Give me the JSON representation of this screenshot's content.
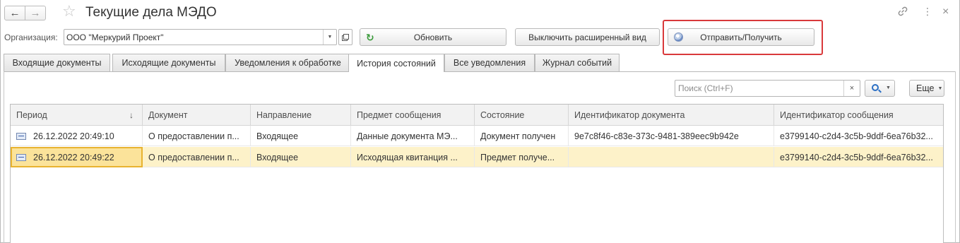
{
  "window": {
    "title": "Текущие дела МЭДО",
    "back_icon": "←",
    "forward_icon": "→",
    "favorite_icon": "☆",
    "link_icon": "🔗",
    "more_icon": "⋮",
    "close_icon": "×"
  },
  "toolbar": {
    "org_label": "Организация:",
    "org_value": "ООО \"Меркурий Проект\"",
    "refresh_label": "Обновить",
    "extended_label": "Выключить расширенный вид",
    "send_label": "Отправить/Получить"
  },
  "tabs": [
    {
      "label": "Входящие документы",
      "active": false
    },
    {
      "label": "Исходящие документы",
      "active": false
    },
    {
      "label": "Уведомления к обработке",
      "active": false
    },
    {
      "label": "История состояний",
      "active": true
    },
    {
      "label": "Все уведомления",
      "active": false
    },
    {
      "label": "Журнал событий",
      "active": false
    }
  ],
  "search": {
    "placeholder": "Поиск (Ctrl+F)",
    "clear_icon": "×",
    "more_label": "Еще"
  },
  "table": {
    "columns": [
      "Период",
      "Документ",
      "Направление",
      "Предмет сообщения",
      "Состояние",
      "Идентификатор документа",
      "Идентификатор сообщения"
    ],
    "sort_indicator": "↓",
    "rows": [
      {
        "cells": [
          "26.12.2022 20:49:10",
          "О предоставлении п...",
          "Входящее",
          "Данные документа МЭ...",
          "Документ получен",
          "9e7c8f46-c83e-373c-9481-389eec9b942e",
          "e3799140-c2d4-3c5b-9ddf-6ea76b32..."
        ],
        "selected": false
      },
      {
        "cells": [
          "26.12.2022 20:49:22",
          "О предоставлении п...",
          "Входящее",
          "Исходящая квитанция ...",
          "Предмет получе...",
          "",
          "e3799140-c2d4-3c5b-9ddf-6ea76b32..."
        ],
        "selected": true
      }
    ]
  },
  "colors": {
    "highlight_border": "#d9393b",
    "selected_row": "#fdf2c9",
    "selected_cell_border": "#e8b330"
  }
}
